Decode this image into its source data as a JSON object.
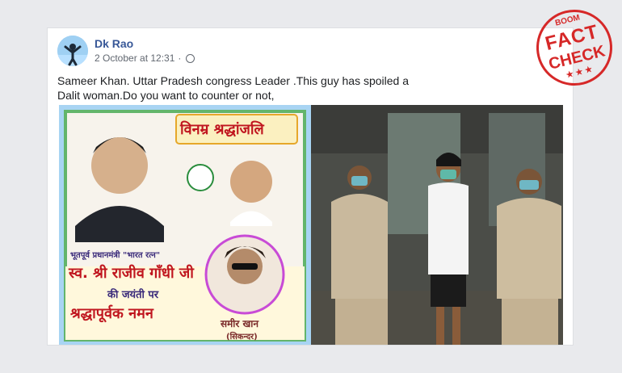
{
  "post": {
    "author": "Dk Rao",
    "timestamp": "2 October at 12:31",
    "caption": "Sameer Khan. Uttar Pradesh congress Leader .This guy has spoiled a Dalit woman.Do you want to counter or not,"
  },
  "poster": {
    "heading": "विनम्र श्रद्धांजलि",
    "subtitle": "भूतपूर्व प्रधानमंत्री \"भारत रत्न\"",
    "name_line": "स्व. श्री राजीव गाँधी जी",
    "line2": "की जयंती पर",
    "line3": "श्रद्धापूर्वक नमन",
    "person_name": "समीर खान",
    "person_alias": "(सिकन्दर)"
  },
  "badge": {
    "brand": "BOOM",
    "line1": "FACT",
    "line2": "CHECK",
    "stars": "★★★"
  },
  "colors": {
    "link": "#385898",
    "badge": "#d62828"
  },
  "icons": [
    "globe-icon"
  ]
}
